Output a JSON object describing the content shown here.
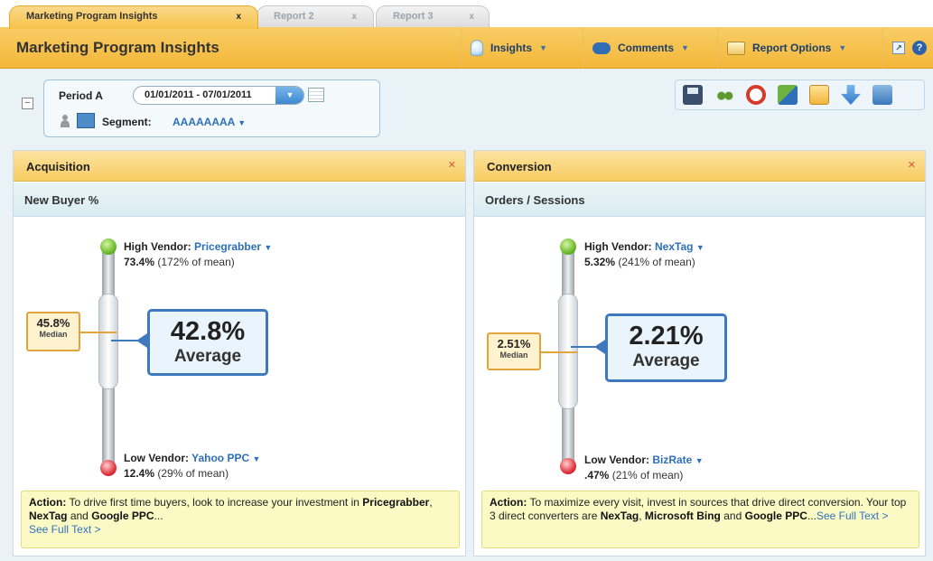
{
  "tabs": [
    {
      "label": "Marketing Program Insights",
      "close": "x",
      "active": true
    },
    {
      "label": "Report 2",
      "close": "x",
      "active": false
    },
    {
      "label": "Report 3",
      "close": "x",
      "active": false
    }
  ],
  "header": {
    "title": "Marketing Program Insights",
    "buttons": [
      {
        "label": "Insights",
        "icon": "lightbulb-icon"
      },
      {
        "label": "Comments",
        "icon": "speech-bubble-icon"
      },
      {
        "label": "Report Options",
        "icon": "folder-icon"
      }
    ],
    "help": "?"
  },
  "filters": {
    "collapse": "−",
    "period_label": "Period A",
    "date_range": "01/01/2011 - 07/01/2011",
    "segment_label": "Segment:",
    "segment_value": "AAAAAAAA"
  },
  "toolbar_icons": [
    "save-icon",
    "find-icon",
    "target-icon",
    "pin-icon",
    "email-icon",
    "download-icon",
    "print-icon"
  ],
  "panels": [
    {
      "title": "Acquisition",
      "metric": "New Buyer %",
      "high_label": "High Vendor:",
      "high_vendor": "Pricegrabber",
      "high_value": "73.4%",
      "high_note": "(172% of mean)",
      "median_value": "45.8%",
      "median_label": "Median",
      "average_value": "42.8%",
      "average_label": "Average",
      "low_label": "Low Vendor:",
      "low_vendor": "Yahoo PPC",
      "low_value": "12.4%",
      "low_note": "(29% of mean)",
      "action": {
        "label": "Action:",
        "text": "To drive first time buyers, look to increase your investment in",
        "b1": "Pricegrabber",
        "sep1": ",",
        "b2": "NexTag",
        "sep2": "and",
        "b3": "Google PPC",
        "ellipsis": "...",
        "link": "See Full Text >"
      }
    },
    {
      "title": "Conversion",
      "metric": "Orders / Sessions",
      "high_label": "High Vendor:",
      "high_vendor": "NexTag",
      "high_value": "5.32%",
      "high_note": "(241% of mean)",
      "median_value": "2.51%",
      "median_label": "Median",
      "average_value": "2.21%",
      "average_label": "Average",
      "low_label": "Low Vendor:",
      "low_vendor": "BizRate",
      "low_value": ".47%",
      "low_note": "(21% of mean)",
      "action": {
        "label": "Action:",
        "text": "To maximize every visit, invest in sources that drive direct conversion. Your top 3 direct converters are",
        "b1": "NexTag",
        "sep1": ",",
        "b2": "Microsoft Bing",
        "sep2": "and",
        "b3": "Google PPC",
        "ellipsis": "...",
        "link": "See Full Text >"
      }
    }
  ]
}
